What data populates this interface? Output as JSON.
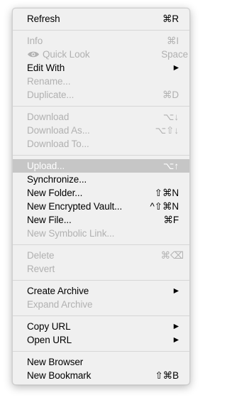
{
  "menu": {
    "items": [
      {
        "label": "Refresh",
        "shortcut": "⌘R",
        "disabled": false
      },
      {
        "label": "Info",
        "shortcut": "⌘I",
        "disabled": true
      },
      {
        "label": "Quick Look",
        "shortcut": "Space",
        "disabled": true,
        "icon": "eye-icon"
      },
      {
        "label": "Edit With",
        "submenu": true,
        "disabled": false
      },
      {
        "label": "Rename...",
        "disabled": true
      },
      {
        "label": "Duplicate...",
        "shortcut": "⌘D",
        "disabled": true
      },
      {
        "label": "Download",
        "shortcut": "⌥↓",
        "disabled": true
      },
      {
        "label": "Download As...",
        "shortcut": "⌥⇧↓",
        "disabled": true
      },
      {
        "label": "Download To...",
        "disabled": true
      },
      {
        "label": "Upload...",
        "shortcut": "⌥↑",
        "disabled": false,
        "highlighted": true
      },
      {
        "label": "Synchronize...",
        "disabled": false
      },
      {
        "label": "New Folder...",
        "shortcut": "⇧⌘N",
        "disabled": false
      },
      {
        "label": "New Encrypted Vault...",
        "shortcut": "^⇧⌘N",
        "disabled": false
      },
      {
        "label": "New File...",
        "shortcut": "⌘F",
        "disabled": false
      },
      {
        "label": "New Symbolic Link...",
        "disabled": true
      },
      {
        "label": "Delete",
        "shortcut": "⌘⌫",
        "disabled": true
      },
      {
        "label": "Revert",
        "disabled": true
      },
      {
        "label": "Create Archive",
        "submenu": true,
        "disabled": false
      },
      {
        "label": "Expand Archive",
        "disabled": true
      },
      {
        "label": "Copy URL",
        "submenu": true,
        "disabled": false
      },
      {
        "label": "Open URL",
        "submenu": true,
        "disabled": false
      },
      {
        "label": "New Browser",
        "disabled": false
      },
      {
        "label": "New Bookmark",
        "shortcut": "⇧⌘B",
        "disabled": false
      }
    ],
    "submenu_arrow": "▶"
  },
  "colors": {
    "menu_background": "#f0f0f0",
    "disabled_text": "#b1b1b1",
    "highlight_background": "#c6c6c6",
    "separator": "#d6d6d6"
  }
}
